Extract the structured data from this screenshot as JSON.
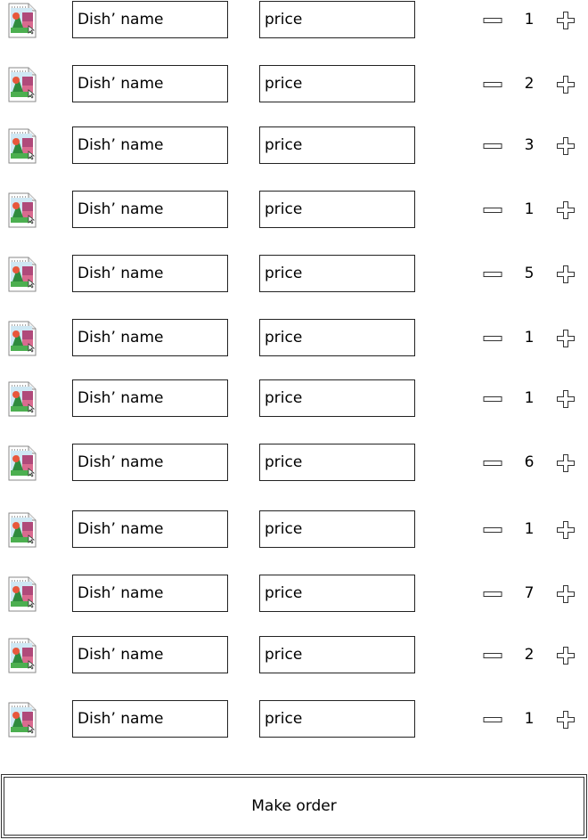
{
  "dishes": [
    {
      "name": "Dish’ name",
      "price": "price",
      "qty": "1"
    },
    {
      "name": "Dish’ name",
      "price": "price",
      "qty": "2"
    },
    {
      "name": "Dish’ name",
      "price": "price",
      "qty": "3"
    },
    {
      "name": "Dish’ name",
      "price": "price",
      "qty": "1"
    },
    {
      "name": "Dish’ name",
      "price": "price",
      "qty": "5"
    },
    {
      "name": "Dish’ name",
      "price": "price",
      "qty": "1"
    },
    {
      "name": "Dish’ name",
      "price": "price",
      "qty": "1"
    },
    {
      "name": "Dish’ name",
      "price": "price",
      "qty": "6"
    },
    {
      "name": "Dish’ name",
      "price": "price",
      "qty": "1"
    },
    {
      "name": "Dish’ name",
      "price": "price",
      "qty": "7"
    },
    {
      "name": "Dish’ name",
      "price": "price",
      "qty": "2"
    },
    {
      "name": "Dish’ name",
      "price": "price",
      "qty": "1"
    }
  ],
  "icons": {
    "thumbnail": "image-placeholder-icon",
    "decrease": "minus-icon",
    "increase": "plus-icon"
  },
  "order_button_label": "Make order"
}
